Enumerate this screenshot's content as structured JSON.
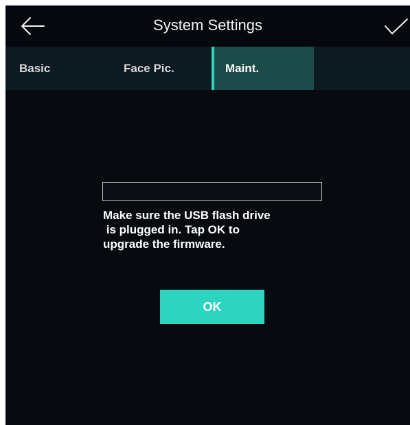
{
  "header": {
    "title": "System Settings",
    "back_icon": "arrow-left-icon",
    "confirm_icon": "checkmark-icon"
  },
  "tabs": [
    {
      "label": "Basic",
      "active": false
    },
    {
      "label": "Face Pic.",
      "active": false
    },
    {
      "label": "Maint.",
      "active": true
    }
  ],
  "upgrade": {
    "progress_percent": 0,
    "message": "Make sure the USB flash drive\n is plugged in. Tap OK to\nupgrade the firmware.",
    "ok_label": "OK"
  },
  "colors": {
    "accent": "#2dd4bf",
    "background": "#070b10",
    "tab_bar": "#0e1a21",
    "active_tab": "#1c4b4a"
  }
}
